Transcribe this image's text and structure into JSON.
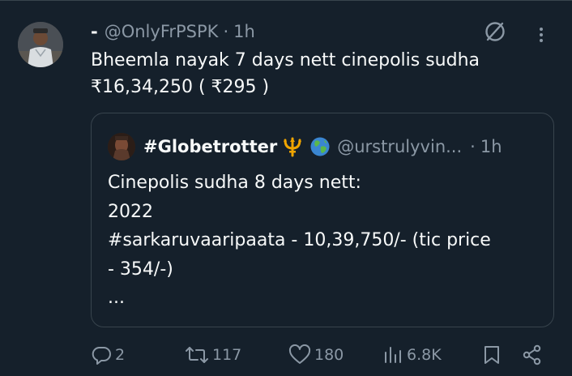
{
  "tweet": {
    "display_name": "-",
    "handle": "@OnlyFrPSPK",
    "separator": "·",
    "time": "1h",
    "text_lines": [
      "Bheemla nayak 7 days nett cinepolis sudha",
      "₹16,34,250 ( ₹295 )"
    ]
  },
  "quote": {
    "display_name": "#Globetrotter",
    "handle": "@urstrulyvin...",
    "separator": "·",
    "time": "1h",
    "text_lines": [
      "Cinepolis sudha 8 days nett:",
      "2022",
      "#sarkaruvaaripaata - 10,39,750/- (tic price",
      "- 354/-)",
      "..."
    ]
  },
  "actions": {
    "replies": "2",
    "retweets": "117",
    "likes": "180",
    "views": "6.8K"
  },
  "icons": {
    "grok": "grok-icon",
    "more": "more-icon",
    "reply": "reply-icon",
    "retweet": "retweet-icon",
    "like": "like-icon",
    "views": "views-icon",
    "bookmark": "bookmark-icon",
    "share": "share-icon"
  },
  "colors": {
    "background": "#15202b",
    "text": "#f7f9f9",
    "muted": "#8b98a5",
    "border": "#38444d"
  }
}
